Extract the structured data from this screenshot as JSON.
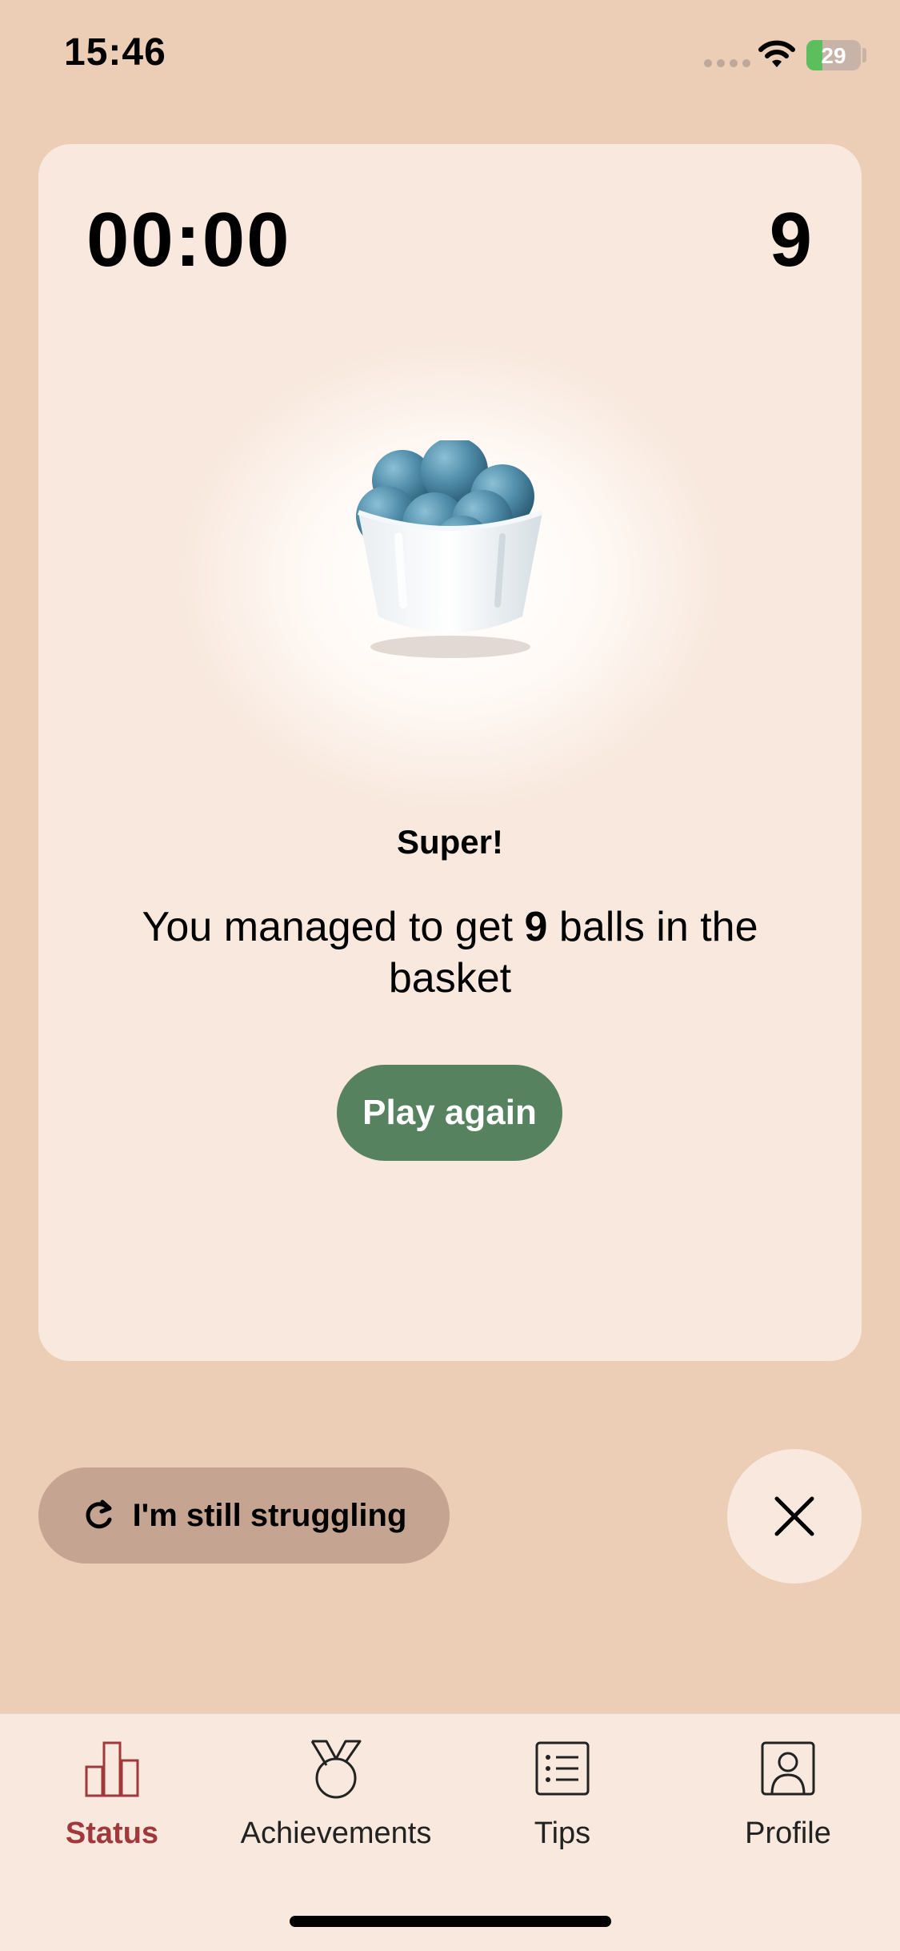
{
  "status_bar": {
    "time": "15:46",
    "battery": "29",
    "battery_level": 0.29
  },
  "game": {
    "timer": "00:00",
    "score": "9",
    "result_title": "Super!",
    "message_prefix": "You managed to get ",
    "message_count": "9",
    "message_suffix": " balls in the basket",
    "play_again_label": "Play again"
  },
  "actions": {
    "struggling_label": "I'm still struggling"
  },
  "tabs": [
    {
      "label": "Status",
      "icon": "bar-chart-icon",
      "active": true
    },
    {
      "label": "Achievements",
      "icon": "medal-icon",
      "active": false
    },
    {
      "label": "Tips",
      "icon": "list-icon",
      "active": false
    },
    {
      "label": "Profile",
      "icon": "profile-icon",
      "active": false
    }
  ],
  "colors": {
    "background": "#ECCDB5",
    "card": "#F8E8DD",
    "primary_button": "#578260",
    "secondary_button": "#C5A591",
    "active_tab": "#A0383C",
    "ball": "#4F8CA8"
  }
}
